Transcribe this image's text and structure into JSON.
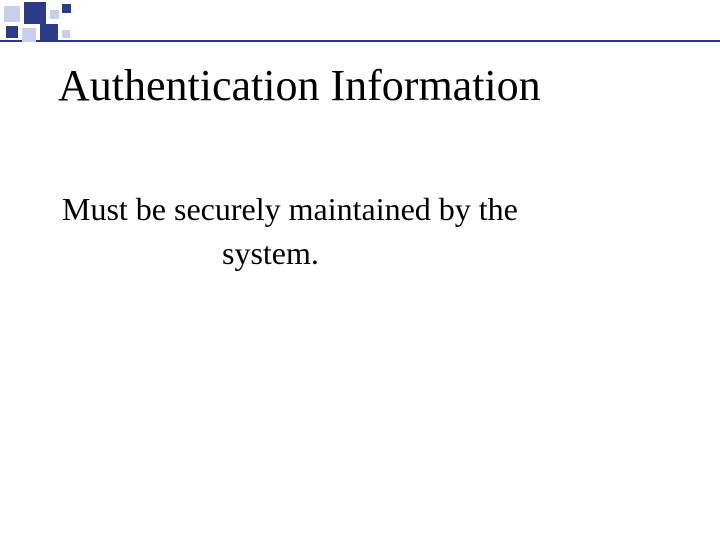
{
  "slide": {
    "title": "Authentication Information",
    "body_line1": "Must be securely maintained by the",
    "body_line2": "system.",
    "accent_color": "#2c3a8a",
    "light_accent": "#c9cfea"
  }
}
